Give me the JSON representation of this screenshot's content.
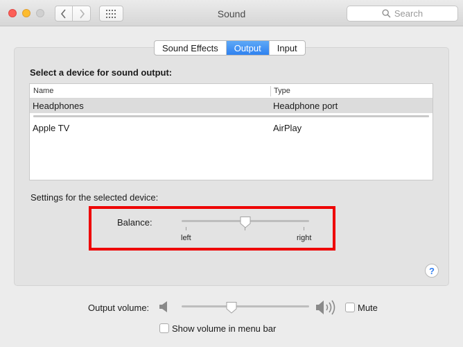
{
  "window": {
    "title": "Sound",
    "search_placeholder": "Search"
  },
  "tabs": [
    {
      "label": "Sound Effects",
      "active": false
    },
    {
      "label": "Output",
      "active": true
    },
    {
      "label": "Input",
      "active": false
    }
  ],
  "output": {
    "heading": "Select a device for sound output:",
    "columns": [
      "Name",
      "Type"
    ],
    "devices": [
      {
        "name": "Headphones",
        "type": "Headphone port",
        "selected": true
      },
      {
        "name": "Apple TV",
        "type": "AirPlay",
        "selected": false
      }
    ],
    "settings_label": "Settings for the selected device:",
    "balance": {
      "label": "Balance:",
      "left_label": "left",
      "right_label": "right",
      "value": 0.5
    }
  },
  "bottom": {
    "volume_label": "Output volume:",
    "volume_value": 0.39,
    "mute_label": "Mute",
    "mute_checked": false,
    "show_volume_label": "Show volume in menu bar",
    "show_volume_checked": false
  },
  "help_glyph": "?",
  "colors": {
    "accent": "#2f82f0",
    "highlight": "#ee0000"
  }
}
